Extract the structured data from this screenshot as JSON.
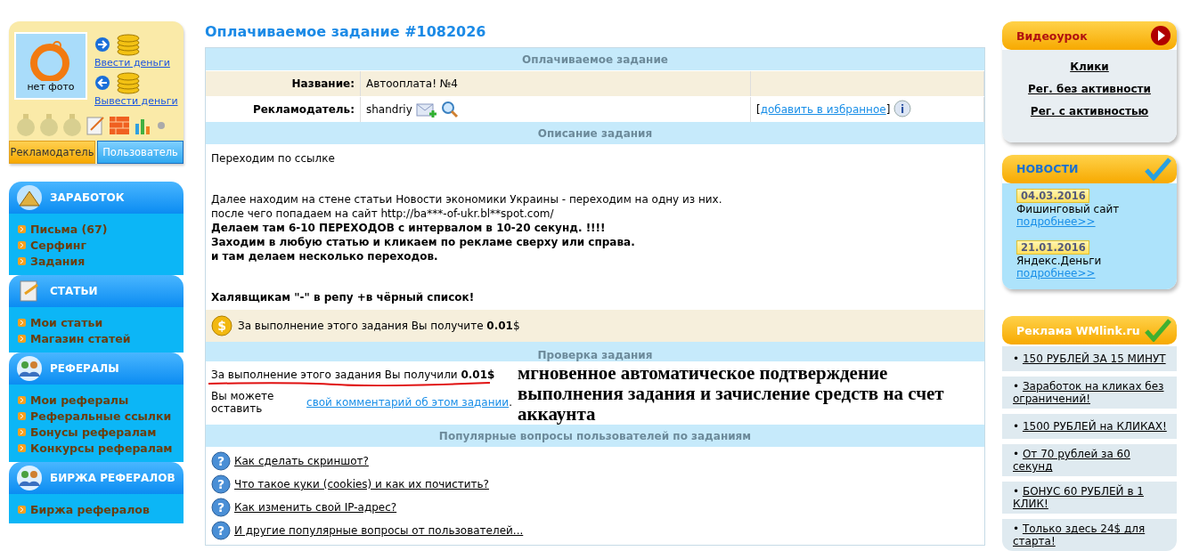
{
  "profile": {
    "photo_label": "нет фото",
    "deposit": "Ввести деньги",
    "withdraw": "Вывести деньги",
    "tabs": [
      {
        "label": "Рекламодатель",
        "selected": true
      },
      {
        "label": "Пользователь",
        "selected": false
      }
    ]
  },
  "menu": [
    {
      "title": "ЗАРАБОТОК",
      "kind": "pyramid",
      "items": [
        "Письма (67)",
        "Серфинг",
        "Задания"
      ]
    },
    {
      "title": "СТАТЬИ",
      "kind": "note",
      "items": [
        "Мои статьи",
        "Магазин статей"
      ]
    },
    {
      "title": "РЕФЕРАЛЫ",
      "kind": "people",
      "items": [
        "Мои рефералы",
        "Реферальные ссылки",
        "Бонусы рефералам",
        "Конкурсы рефералам"
      ]
    },
    {
      "title": "БИРЖА РЕФЕРАЛОВ",
      "kind": "people",
      "items": [
        "Биржа рефералов"
      ]
    }
  ],
  "page_title": "Оплачиваемое задание #1082026",
  "task": {
    "header": "Оплачиваемое задание",
    "name_label": "Название:",
    "name_value": "Автооплата! №4",
    "advertiser_label": "Рекламодатель:",
    "advertiser_value": "shandriy",
    "info_glyph": "i",
    "reward_glyph": "$",
    "favorite_open": "[",
    "favorite_link": "добавить в избранное",
    "favorite_close": "]",
    "description_header": "Описание задания",
    "paragraphs": [
      {
        "lines": [
          {
            "text": "Переходим по ссылке",
            "bold": false
          }
        ]
      },
      {
        "lines": [
          {
            "text": "Далее находим на стене статьи Новости экономики Украины - переходим на одну из них.",
            "bold": false
          },
          {
            "text": "после чего попадаем на сайт http://ba***-of-ukr.bl**spot.com/",
            "bold": false
          },
          {
            "text": "Делаем там 6-10 ПЕРЕХОДОВ с интервалом в 10-20 секунд. !!!!",
            "bold": true
          },
          {
            "text": "Заходим в любую статью и кликаем по рекламе сверху или справа.",
            "bold": true
          },
          {
            "text": "и там делаем несколько переходов.",
            "bold": true
          }
        ]
      },
      {
        "lines": [
          {
            "text": "Халявщикам \"-\" в репу +в чёрный список!",
            "bold": true
          }
        ]
      }
    ],
    "reward": "За выполнение этого задания Вы получите **0.01**$",
    "check_header": "Проверка задания",
    "received": "За выполнение этого задания Вы получили **0.01$**",
    "comment_prefix": "Вы можете оставить",
    "comment_link": "свой комментарий об этом задании",
    "comment_suffix": ".",
    "faq_header": "Популярные вопросы пользователей по заданиям",
    "faq": [
      {
        "glyph": "?",
        "text": "Как сделать скриншот?"
      },
      {
        "glyph": "?",
        "text": "Что такое куки (cookies) и как их почистить?"
      },
      {
        "glyph": "?",
        "text": "Как изменить свой IP-адрес?"
      },
      {
        "glyph": "?",
        "text": "И другие популярные вопросы от пользователей..."
      }
    ]
  },
  "annotation": "мгновенное автоматическое подтверждение выполнения задания и зачисление средств на счет аккаунта",
  "video": {
    "title": "Видеоурок",
    "links": [
      "Клики",
      "Рег. без активности",
      "Рег. с активностью"
    ]
  },
  "news": {
    "title": "НОВОСТИ",
    "items": [
      {
        "date": "04.03.2016",
        "title": "Фишинговый сайт",
        "more": "подробнее>>"
      },
      {
        "date": "21.01.2016",
        "title": "Яндекс.Деньги",
        "more": "подробнее>>"
      }
    ]
  },
  "ads": {
    "title": "Реклама WMlink.ru",
    "bullet": "•",
    "items": [
      "150 РУБЛЕЙ ЗА 15 МИНУТ",
      "Заработок на кликах без ограничений!",
      "1500 РУБЛЕЙ на КЛИКАХ!",
      "От 70 рублей за 60 секунд",
      "БОНУС 60 РУБЛЕЙ в 1 КЛИК!",
      "Только здесь 24$ для старта!"
    ]
  }
}
